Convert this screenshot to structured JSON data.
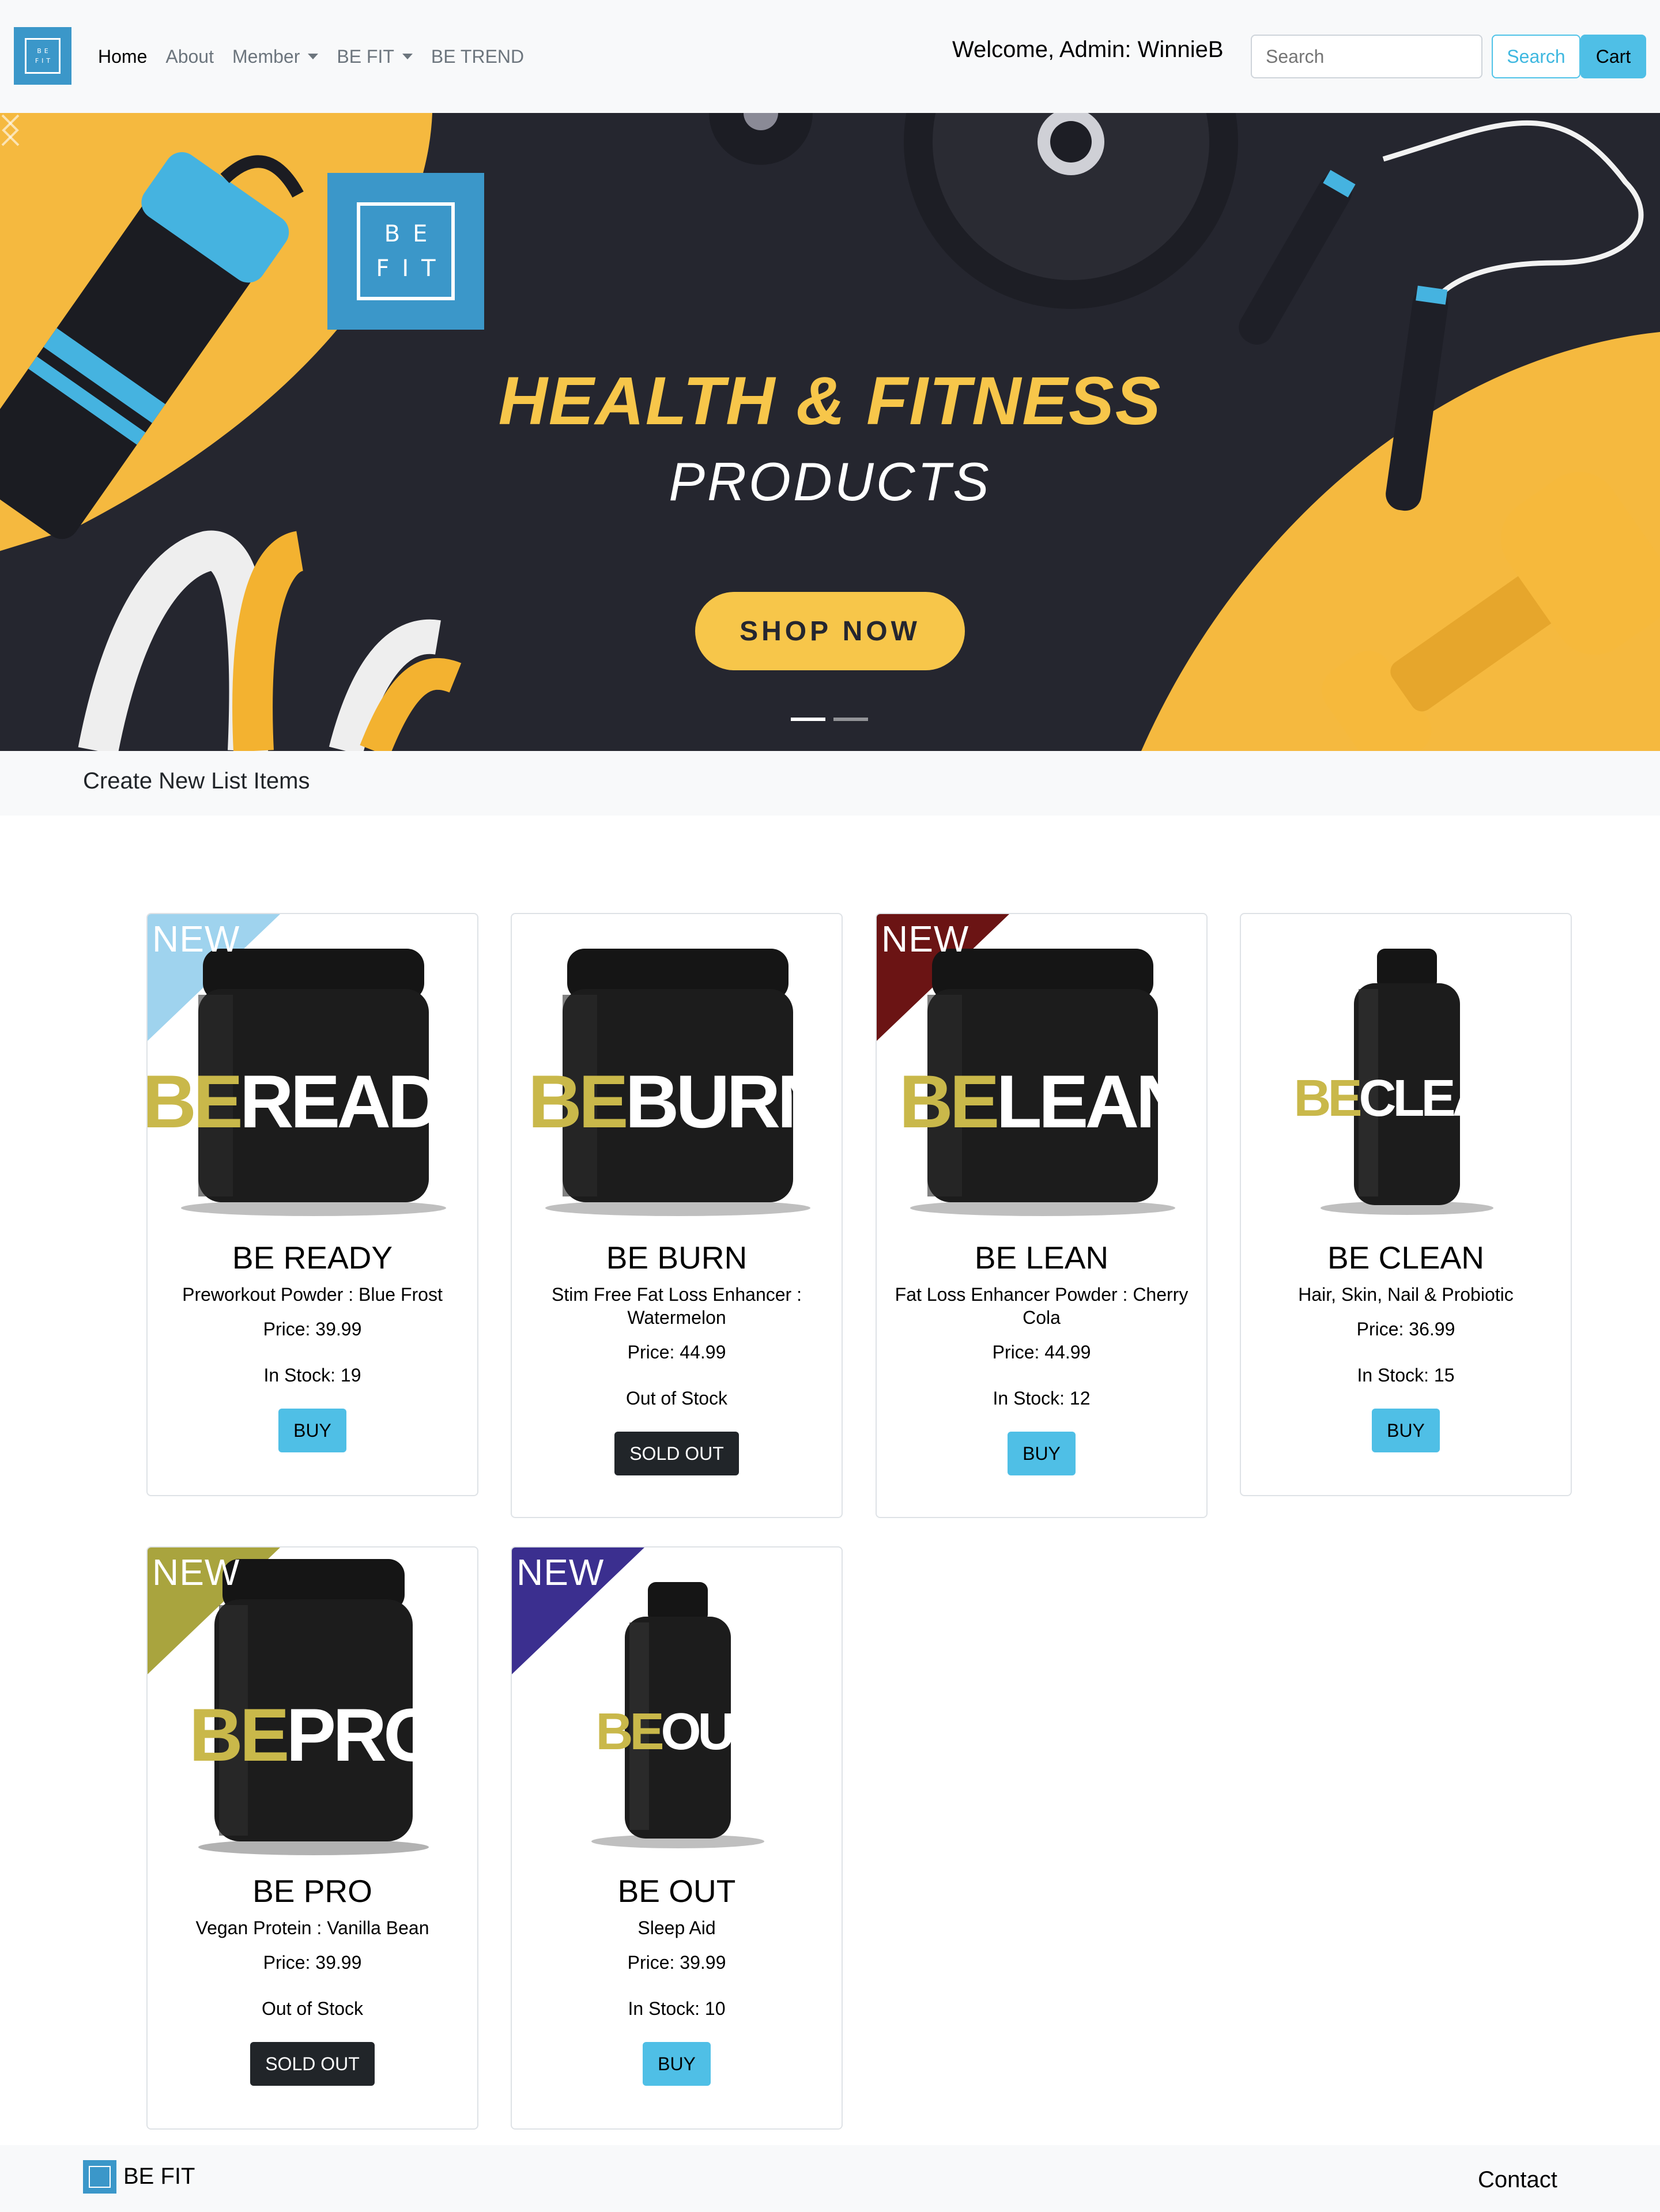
{
  "brand": {
    "logo_text_line1": "BE",
    "logo_text_line2": "FIT",
    "name": "BE FIT"
  },
  "nav": {
    "items": [
      {
        "label": "Home",
        "active": true
      },
      {
        "label": "About"
      },
      {
        "label": "Member",
        "dropdown": true
      },
      {
        "label": "BE FIT",
        "dropdown": true
      },
      {
        "label": "BE TREND"
      }
    ],
    "welcome": "Welcome, Admin: WinnieB",
    "search_placeholder": "Search",
    "search_button": "Search",
    "cart_button": "Cart"
  },
  "hero": {
    "logo_line1": "BE",
    "logo_line2": "FIT",
    "title": "HEALTH & FITNESS",
    "subtitle": "PRODUCTS",
    "cta": "SHOP NOW",
    "slides": 2,
    "active_slide": 1,
    "colors": {
      "background": "#25262f",
      "accent": "#f7c64a",
      "blue": "#3b97c9"
    }
  },
  "subbar": {
    "link": "Create New List Items"
  },
  "products": [
    {
      "name": "BE READY",
      "description": "Preworkout Powder : Blue Frost",
      "price": "Price: 39.99",
      "stock": "In Stock: 19",
      "button": "BUY",
      "label_be": "BE",
      "label_rest": "READY",
      "ribbon": "NEW",
      "ribbon_color": "#9fd3ee"
    },
    {
      "name": "BE BURN",
      "description": "Stim Free Fat Loss Enhancer : Watermelon",
      "price": "Price: 44.99",
      "stock": "Out of Stock",
      "button": "SOLD OUT",
      "label_be": "BE",
      "label_rest": "BURN"
    },
    {
      "name": "BE LEAN",
      "description": "Fat Loss Enhancer Powder : Cherry Cola",
      "price": "Price: 44.99",
      "stock": "In Stock: 12",
      "button": "BUY",
      "label_be": "BE",
      "label_rest": "LEAN",
      "ribbon": "NEW",
      "ribbon_color": "#6b1414"
    },
    {
      "name": "BE CLEAN",
      "description": "Hair, Skin, Nail & Probiotic",
      "price": "Price: 36.99",
      "stock": "In Stock: 15",
      "button": "BUY",
      "label_be": "BE",
      "label_rest": "CLEAN"
    },
    {
      "name": "BE PRO",
      "description": "Vegan Protein : Vanilla Bean",
      "price": "Price: 39.99",
      "stock": "Out of Stock",
      "button": "SOLD OUT",
      "label_be": "BE",
      "label_rest": "PRO",
      "ribbon": "NEW",
      "ribbon_color": "#a9a43e"
    },
    {
      "name": "BE OUT",
      "description": "Sleep Aid",
      "price": "Price: 39.99",
      "stock": "In Stock: 10",
      "button": "BUY",
      "label_be": "BE",
      "label_rest": "OUT",
      "ribbon": "NEW",
      "ribbon_color": "#3b2f8f"
    }
  ],
  "footer": {
    "brand": "BE FIT",
    "contact": "Contact"
  }
}
